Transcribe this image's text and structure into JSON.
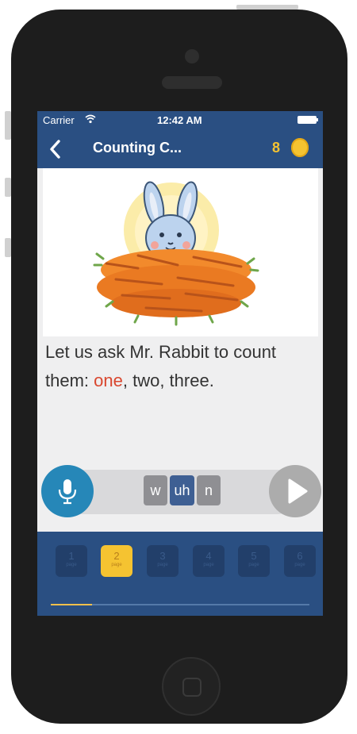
{
  "status": {
    "carrier": "Carrier",
    "time": "12:42 AM"
  },
  "nav": {
    "title": "Counting C...",
    "coins": "8"
  },
  "story": {
    "before": "Let us ask Mr. Rabbit to count them: ",
    "highlight": "one",
    "after": ", two, three."
  },
  "phonemes": [
    {
      "text": "w",
      "active": false
    },
    {
      "text": "uh",
      "active": true
    },
    {
      "text": "n",
      "active": false
    }
  ],
  "pages": [
    {
      "number": "1",
      "label": "page"
    },
    {
      "number": "2",
      "label": "page",
      "active": true
    },
    {
      "number": "3",
      "label": "page"
    },
    {
      "number": "4",
      "label": "page"
    },
    {
      "number": "5",
      "label": "page"
    },
    {
      "number": "6",
      "label": "page"
    }
  ],
  "progress_fraction": 0.16,
  "colors": {
    "brand": "#2a4f82",
    "coin": "#f5c331",
    "highlight": "#d9472f",
    "mic": "#2687b8"
  }
}
